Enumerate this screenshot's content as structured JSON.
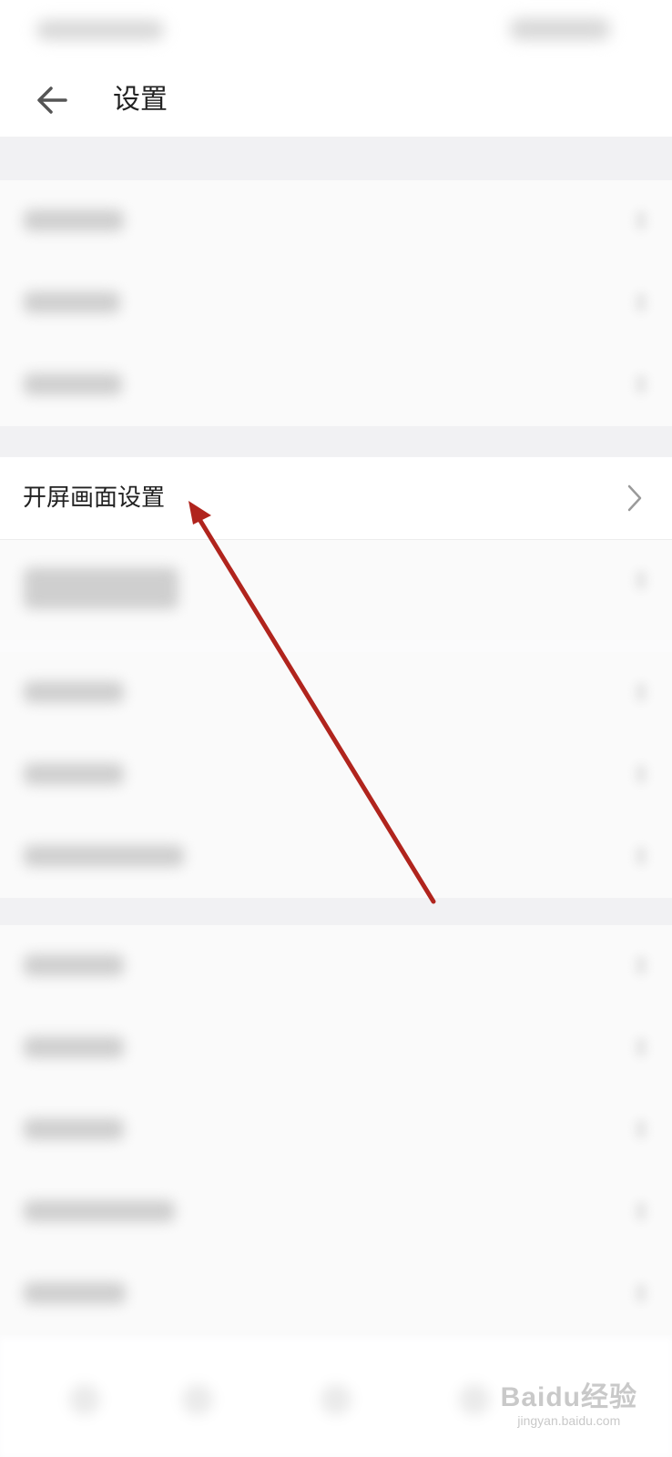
{
  "header": {
    "title": "设置",
    "back_icon": "arrow-left-icon"
  },
  "highlighted_item": {
    "label": "开屏画面设置",
    "icon": "chevron-right-icon"
  },
  "watermark": {
    "logo": "Baidu经验",
    "url": "jingyan.baidu.com"
  },
  "colors": {
    "arrow": "#b0241d",
    "text": "#222222",
    "chevron": "#9a9a9a"
  }
}
